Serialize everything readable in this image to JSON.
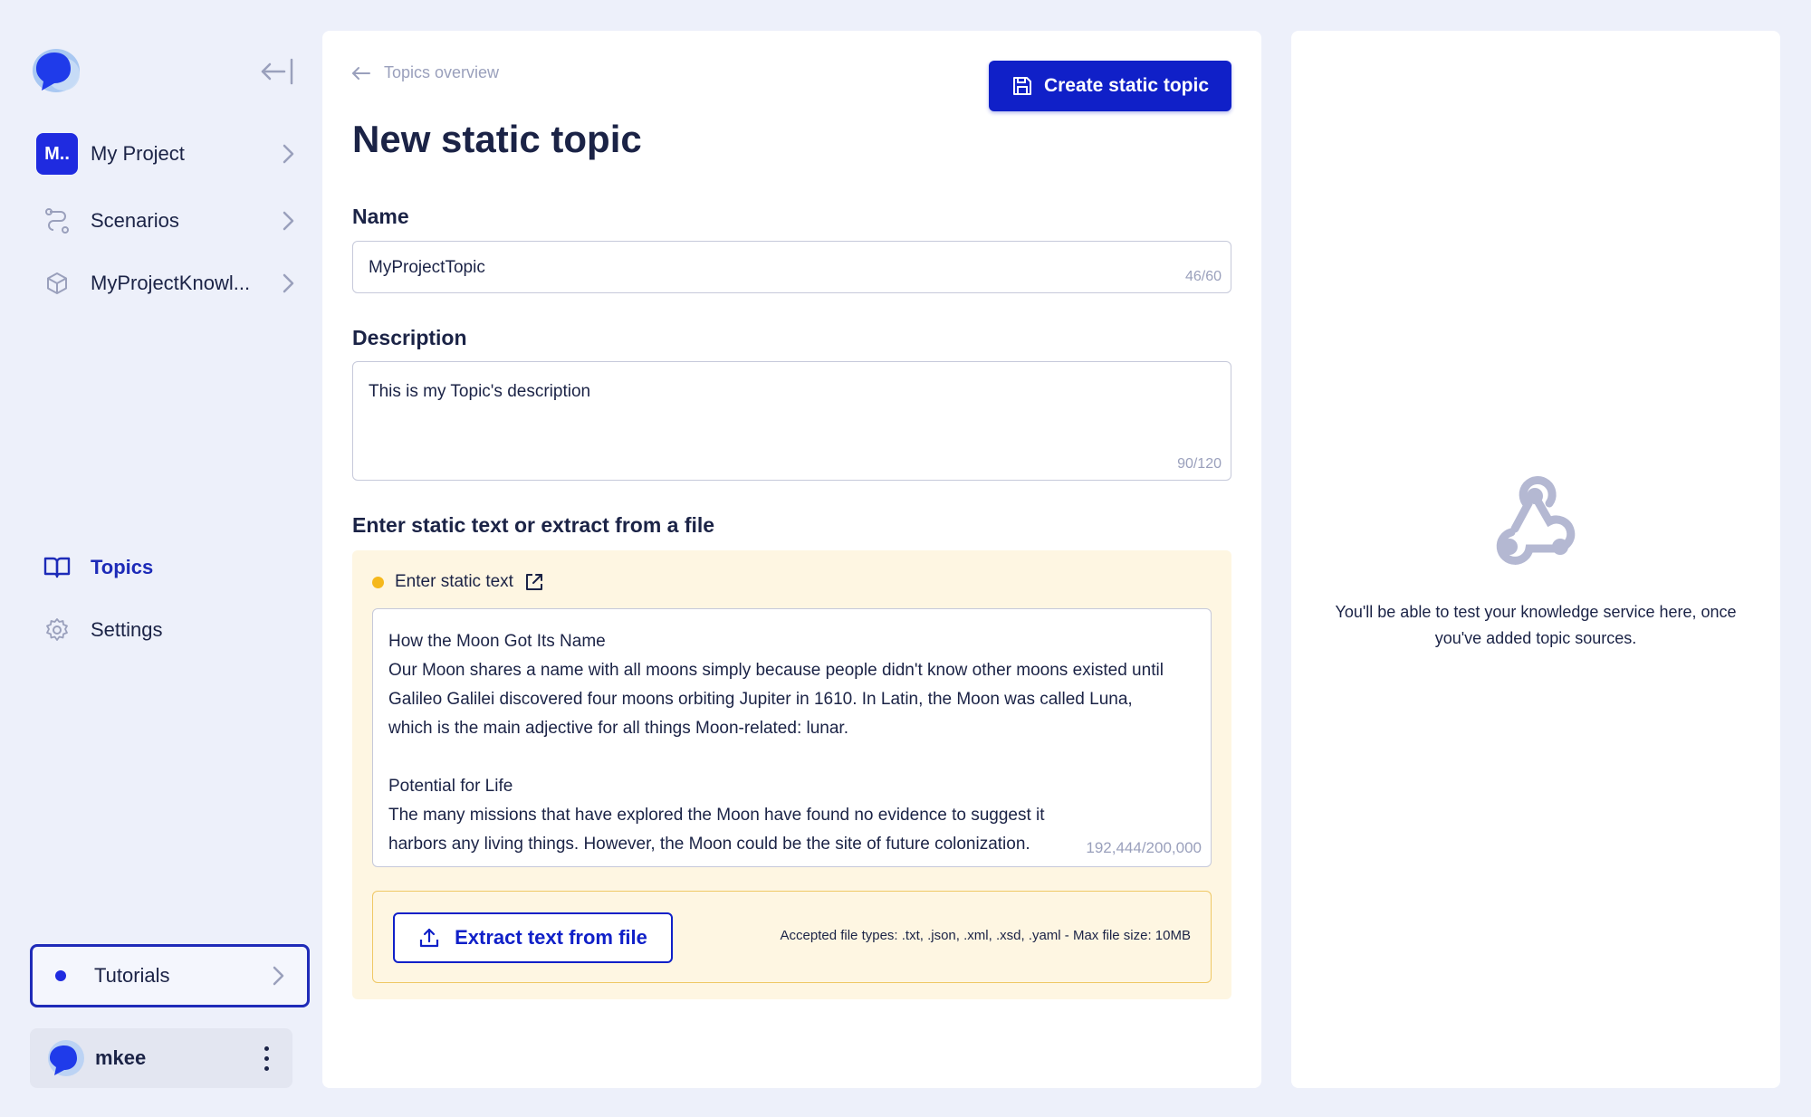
{
  "colors": {
    "page_bg": "#edf0fa",
    "primary": "#1020c8",
    "badge": "#1f2be0",
    "static_bg": "#fef6e2",
    "static_dot": "#f5b81c",
    "muted": "#9aa0bc",
    "text": "#1b2346"
  },
  "sidebar": {
    "logo_icon": "speech-bubble-logo",
    "collapse_icon": "collapse-left-icon",
    "items": [
      {
        "badge": "M..",
        "label": "My Project",
        "icon": "project-badge"
      },
      {
        "label": "Scenarios",
        "icon": "route-icon"
      },
      {
        "label": "MyProjectKnowl...",
        "icon": "cube-icon"
      },
      {
        "label": "Topics",
        "icon": "book-icon",
        "active": true
      },
      {
        "label": "Settings",
        "icon": "gear-icon"
      }
    ],
    "tutorials": {
      "label": "Tutorials"
    },
    "user": {
      "name": "mkee"
    }
  },
  "main": {
    "breadcrumb": "Topics overview",
    "create_button": "Create static topic",
    "title": "New static topic",
    "name_field": {
      "label": "Name",
      "value": "MyProjectTopic",
      "counter": "46/60"
    },
    "description_field": {
      "label": "Description",
      "value": "This is my Topic's description",
      "counter": "90/120"
    },
    "static_section": {
      "heading": "Enter static text or extract from a file",
      "mode_label": "Enter static text",
      "text": "How the Moon Got Its Name\nOur Moon shares a name with all moons simply because people didn't know other moons existed until Galileo Galilei discovered four moons orbiting Jupiter in 1610. In Latin, the Moon was called Luna, which is the main adjective for all things Moon-related: lunar.\n\nPotential for Life\nThe many missions that have explored the Moon have found no evidence to suggest it\nharbors any living things. However, the Moon could be the site of future colonization.",
      "counter": "192,444/200,000",
      "extract_button": "Extract text from file",
      "accepted_types": "Accepted file types: .txt, .json, .xml, .xsd, .yaml - Max file size: 10MB"
    }
  },
  "right_panel": {
    "icon": "webhook-icon",
    "message": "You'll be able to test your knowledge service here, once you've added topic sources."
  }
}
